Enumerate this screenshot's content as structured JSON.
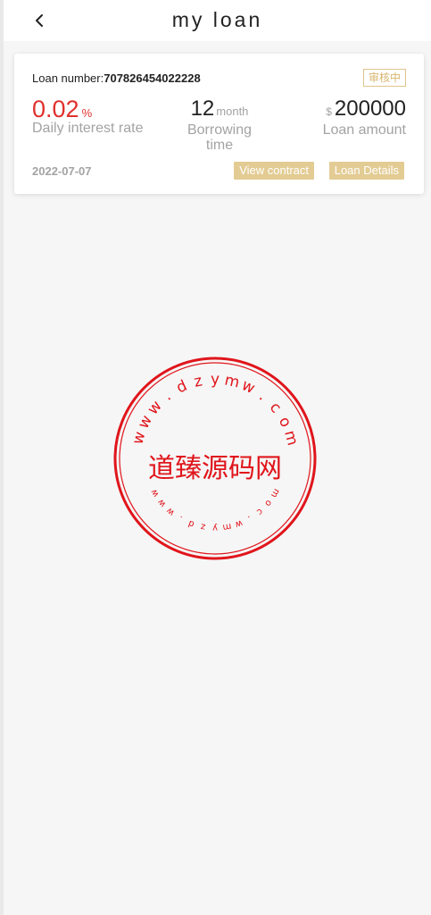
{
  "header": {
    "title": "my loan",
    "back_icon": "chevron-left-icon"
  },
  "loan": {
    "number_label": "Loan number:",
    "number": "707826454022228",
    "status": "审核中",
    "rate_value": "0.02",
    "rate_unit": "%",
    "rate_label": "Daily interest rate",
    "term_value": "12",
    "term_unit": "month",
    "term_label": "Borrowing time",
    "amount_currency": "$",
    "amount_value": "200000",
    "amount_label": "Loan amount",
    "date": "2022-07-07",
    "view_contract_label": "View contract",
    "loan_details_label": "Loan Details"
  },
  "watermark": {
    "text": "道臻源码网",
    "url": "www.dzymw.com",
    "color": "#e0151b"
  },
  "colors": {
    "accent_red": "#e0302c",
    "button_gold": "#e3cc94",
    "badge_gold": "#d9b56e"
  }
}
